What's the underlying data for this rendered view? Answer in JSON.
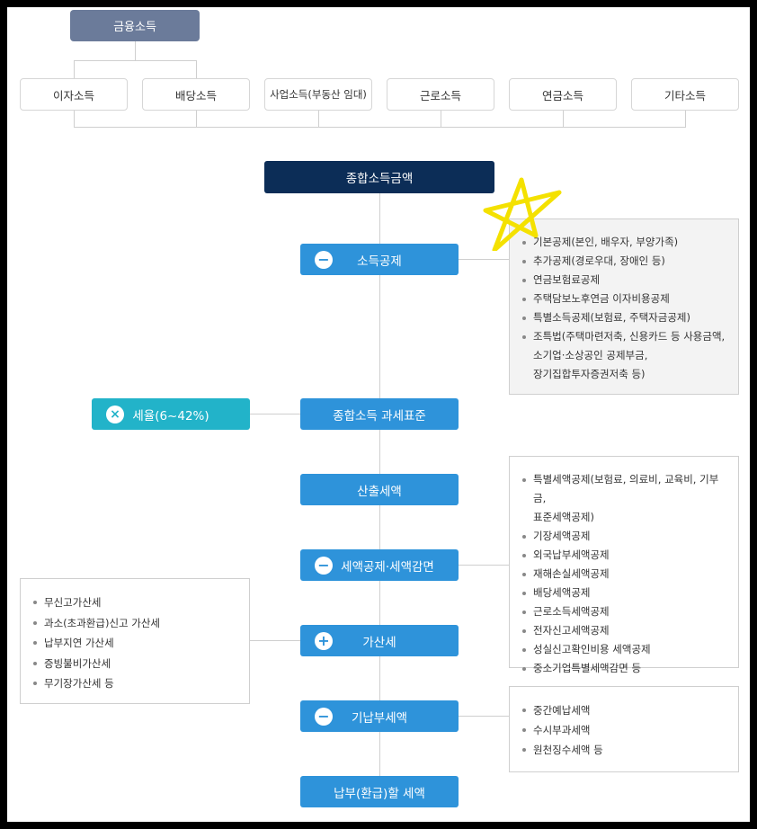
{
  "header": {
    "label": "금융소득"
  },
  "sources": [
    {
      "label": "이자소득"
    },
    {
      "label": "배당소득"
    },
    {
      "label": "사업소득(부동산 임대)"
    },
    {
      "label": "근로소득"
    },
    {
      "label": "연금소득"
    },
    {
      "label": "기타소득"
    }
  ],
  "total_income": {
    "label": "종합소득금액"
  },
  "income_deduction": {
    "sign": "−",
    "label": "소득공제",
    "items": [
      "기본공제(본인, 배우자, 부양가족)",
      "추가공제(경로우대, 장애인 등)",
      "연금보험료공제",
      "주택담보노후연금 이자비용공제",
      "특별소득공제(보험료, 주택자금공제)",
      "조특법(주택마련저축, 신용카드 등 사용금액,",
      "소기업·소상공인 공제부금,",
      "장기집합투자증권저축 등)"
    ]
  },
  "tax_rate": {
    "sign": "×",
    "label": "세율(6~42%)"
  },
  "tax_base": {
    "label": "종합소득 과세표준"
  },
  "computed_tax": {
    "label": "산출세액"
  },
  "tax_credit": {
    "sign": "−",
    "label": "세액공제·세액감면",
    "items": [
      "특별세액공제(보험료, 의료비, 교육비, 기부금,",
      "표준세액공제)",
      "기장세액공제",
      "외국납부세액공제",
      "재해손실세액공제",
      "배당세액공제",
      "근로소득세액공제",
      "전자신고세액공제",
      "성실신고확인비용 세액공제",
      "중소기업특별세액감면 등"
    ]
  },
  "additional_tax": {
    "sign": "+",
    "label": "가산세",
    "items": [
      "무신고가산세",
      "과소(초과환급)신고 가산세",
      "납부지연 가산세",
      "증빙불비가산세",
      "무기장가산세 등"
    ]
  },
  "prepaid_tax": {
    "sign": "−",
    "label": "기납부세액",
    "items": [
      "중간예납세액",
      "수시부과세액",
      "원천징수세액 등"
    ]
  },
  "final_tax": {
    "label": "납부(환급)할 세액"
  },
  "colors": {
    "header": "#6b7b9a",
    "total": "#0c2d57",
    "step": "#2e93da",
    "rate": "#22b3c9",
    "star": "#f4e100"
  }
}
